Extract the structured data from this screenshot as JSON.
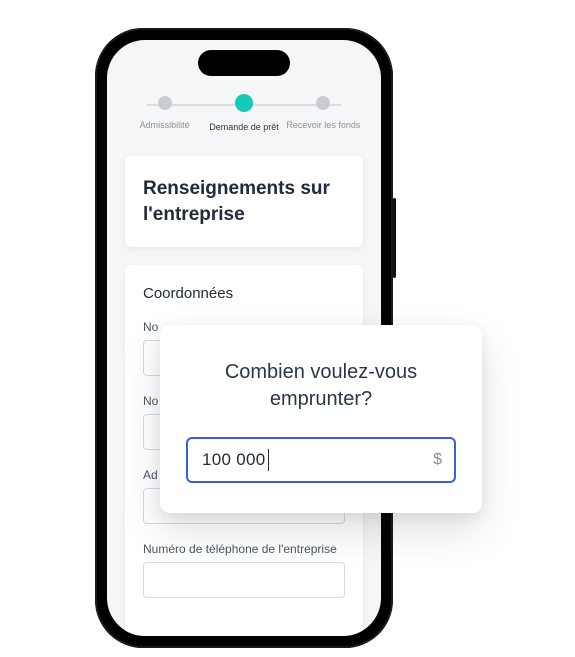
{
  "progress": {
    "steps": [
      {
        "label": "Admissibilité",
        "active": false
      },
      {
        "label": "Demande de prêt",
        "active": true
      },
      {
        "label": "Recevoir les fonds",
        "active": false
      }
    ]
  },
  "header": {
    "title": "Renseignements sur l'entreprise"
  },
  "contact_section": {
    "title": "Coordonnées",
    "fields": {
      "name1_label": "No",
      "name2_label": "No",
      "address_label": "Ad",
      "phone_label": "Numéro de téléphone de l'entreprise"
    }
  },
  "modal": {
    "title": "Combien voulez-vous emprunter?",
    "amount_value": "100 000",
    "currency_symbol": "$"
  }
}
